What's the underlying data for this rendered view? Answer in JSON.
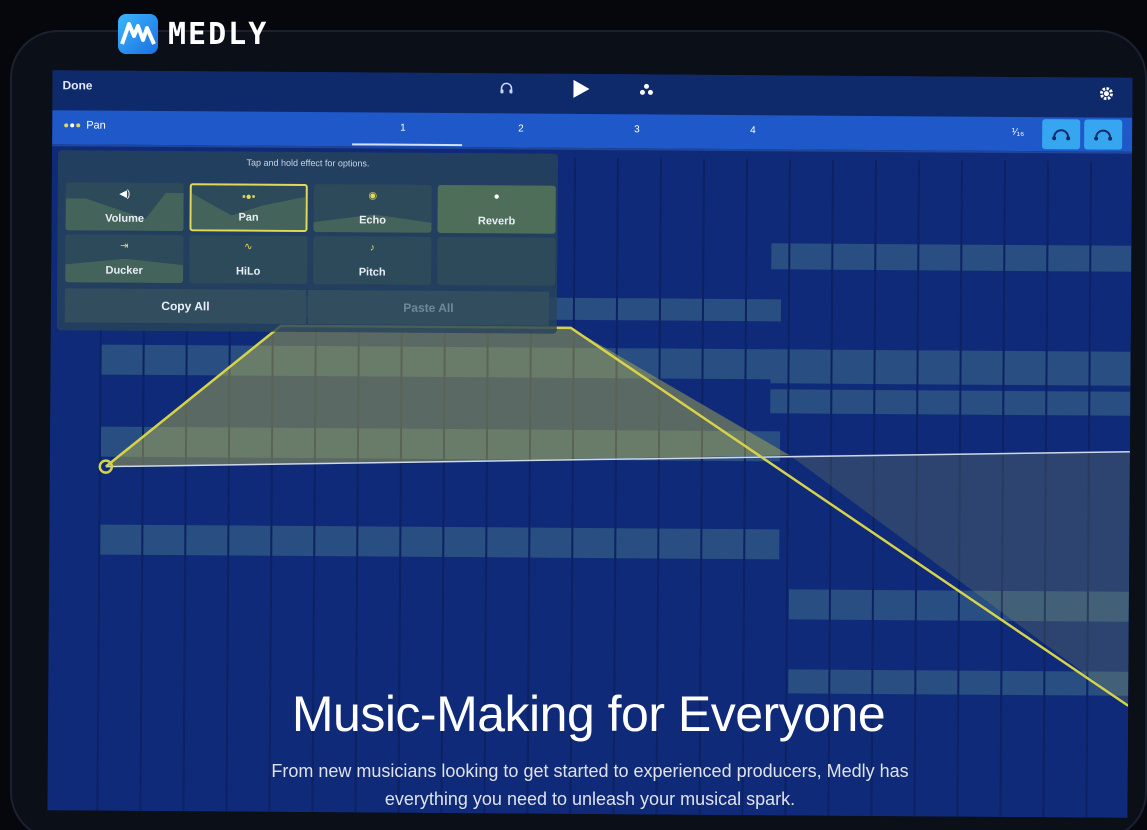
{
  "brand": {
    "name": "MEDLY"
  },
  "topbar": {
    "done_label": "Done",
    "icons": [
      "headphones-icon",
      "play-icon",
      "instrument-icon",
      "gear-icon"
    ]
  },
  "trackbar": {
    "track_label": "Pan",
    "bars": [
      "1",
      "2",
      "3",
      "4"
    ],
    "quantize": "¹⁄₁₆",
    "buttons": [
      "loop-icon",
      "loop-icon"
    ]
  },
  "effects_panel": {
    "hint": "Tap and hold effect for options.",
    "effects": [
      {
        "label": "Volume",
        "icon": "speaker-icon"
      },
      {
        "label": "Pan",
        "icon": "pan-dots-icon",
        "selected": true
      },
      {
        "label": "Echo",
        "icon": "echo-icon"
      },
      {
        "label": "Reverb",
        "icon": "reverb-icon"
      },
      {
        "label": "Ducker",
        "icon": "ducker-icon"
      },
      {
        "label": "HiLo",
        "icon": "hilo-icon"
      },
      {
        "label": "Pitch",
        "icon": "pitch-icon"
      }
    ],
    "copy_all": "Copy All",
    "paste_all": "Paste All"
  },
  "hero": {
    "headline": "Music-Making for Everyone",
    "subline": "From new musicians looking to get started to experienced producers, Medly has everything you need to unleash your musical spark."
  },
  "colors": {
    "accent": "#e4d85a",
    "track_bar": "#1e58c9",
    "grid": "#0f2a78",
    "button": "#37a6f0"
  }
}
